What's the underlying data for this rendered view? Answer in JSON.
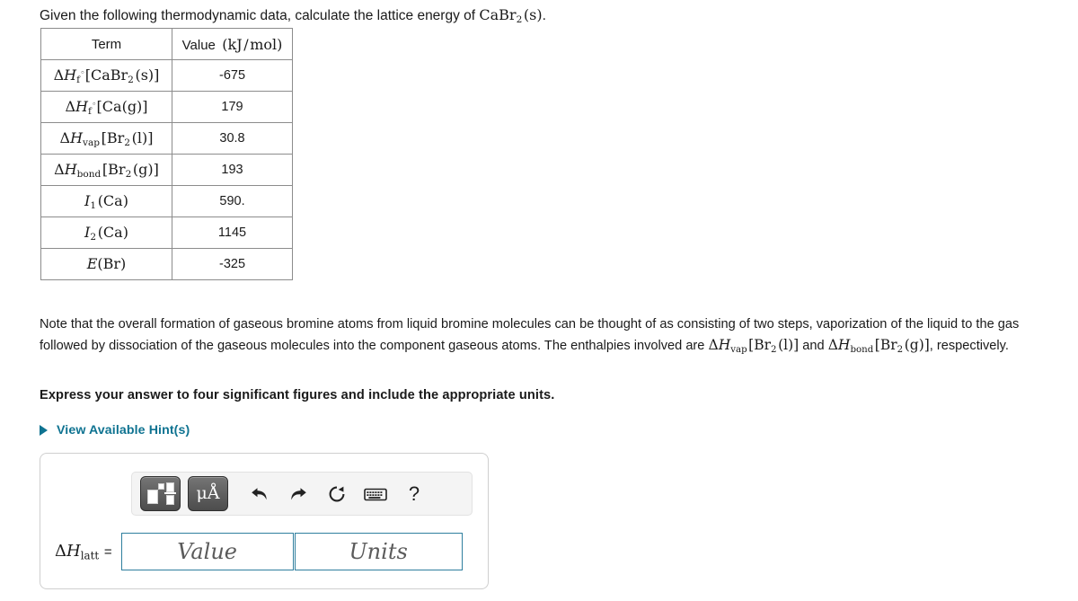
{
  "question": {
    "prompt_lead": "Given the following thermodynamic data, calculate the lattice energy of",
    "prompt_formula": "CaBr2(s).",
    "prompt_formula_parts": {
      "base": "CaBr",
      "sub": "2",
      "state": "(s)",
      "period": "."
    }
  },
  "table": {
    "headers": {
      "term": "Term",
      "value_label": "Value",
      "value_unit": "(kJ/mol)"
    },
    "rows": [
      {
        "term_latex": "ΔHf°[CaBr2(s)]",
        "term_symbol": "ΔH",
        "term_sub": "f",
        "term_sup": "°",
        "term_arg": "[CaBr2(s)]",
        "value": "-675"
      },
      {
        "term_latex": "ΔHf°[Ca(g)]",
        "term_symbol": "ΔH",
        "term_sub": "f",
        "term_sup": "°",
        "term_arg": "[Ca(g)]",
        "value": "179"
      },
      {
        "term_latex": "ΔHvap[Br2(l)]",
        "term_symbol": "ΔH",
        "term_sub": "vap",
        "term_sup": "",
        "term_arg": "[Br2(l)]",
        "value": "30.8"
      },
      {
        "term_latex": "ΔHbond[Br2(g)]",
        "term_symbol": "ΔH",
        "term_sub": "bond",
        "term_sup": "",
        "term_arg": "[Br2(g)]",
        "value": "193"
      },
      {
        "term_latex": "I1(Ca)",
        "term_symbol": "I",
        "term_sub": "1",
        "term_sup": "",
        "term_arg": "(Ca)",
        "value": "590."
      },
      {
        "term_latex": "I2(Ca)",
        "term_symbol": "I",
        "term_sub": "2",
        "term_sup": "",
        "term_arg": "(Ca)",
        "value": "1145"
      },
      {
        "term_latex": "E(Br)",
        "term_symbol": "E",
        "term_sub": "",
        "term_sup": "",
        "term_arg": "(Br)",
        "value": "-325"
      }
    ]
  },
  "note": {
    "part1": "Note that the overall formation of gaseous bromine atoms from liquid bromine molecules can be thought of as consisting of two steps, vaporization of the liquid to the gas followed by dissociation of the gaseous molecules into the component gaseous atoms.  The enthalpies involved are",
    "formula1": "ΔHvap[Br2(l)]",
    "part2": "and",
    "formula2": "ΔHbond[Br2(g)]",
    "part3": ", respectively."
  },
  "instruction": "Express your answer to four significant figures and include the appropriate units.",
  "hints": {
    "label": "View Available Hint(s)",
    "color": "#0f7391",
    "triangle": "triangle-right-icon"
  },
  "answer_panel": {
    "toolbar": {
      "buttons": [
        {
          "name": "math-templates-button",
          "label": "templates"
        },
        {
          "name": "units-button",
          "label": "μÅ"
        },
        {
          "name": "undo-button",
          "label": "undo"
        },
        {
          "name": "redo-button",
          "label": "redo"
        },
        {
          "name": "reset-button",
          "label": "reset"
        },
        {
          "name": "keyboard-button",
          "label": "keyboard"
        },
        {
          "name": "help-button",
          "label": "?"
        }
      ],
      "units_label": "μÅ",
      "help_label": "?"
    },
    "answer_label_symbol": "ΔH",
    "answer_label_sub": "latt",
    "answer_label_equals": "=",
    "value_placeholder": "Value",
    "value_current": "",
    "units_placeholder": "Units",
    "units_current": "",
    "field_border_color": "#2f7f9e"
  }
}
